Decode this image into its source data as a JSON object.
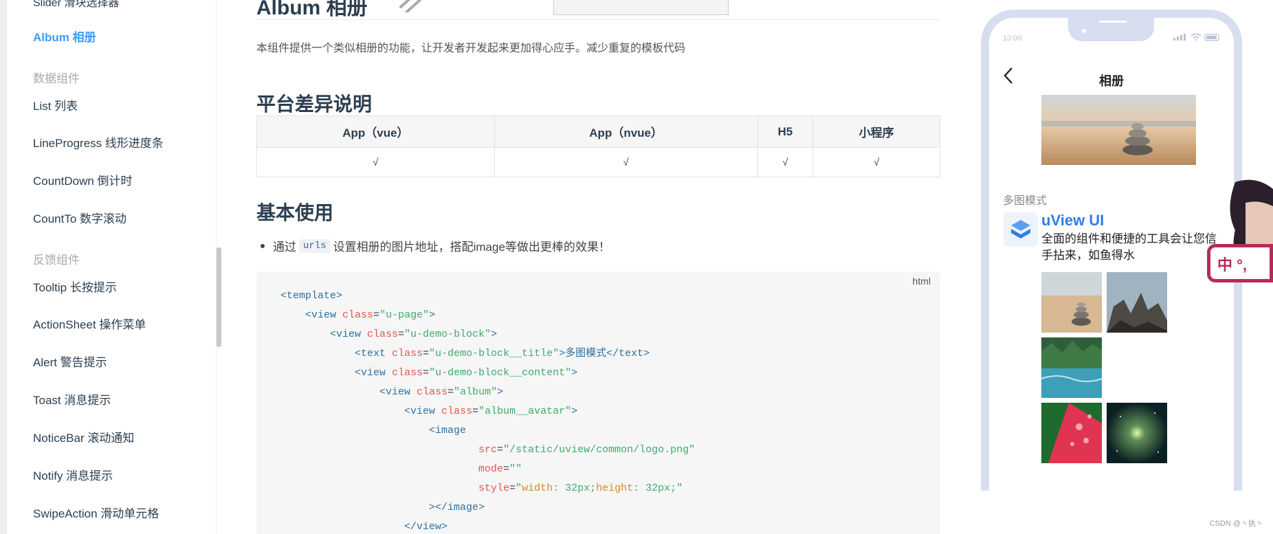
{
  "sidebar": {
    "top_partial": "Slider 滑块选择器",
    "items": [
      {
        "label": "Album 相册",
        "active": true
      },
      {
        "label": "数据组件",
        "group": true
      },
      {
        "label": "List 列表"
      },
      {
        "label": "LineProgress 线形进度条"
      },
      {
        "label": "CountDown 倒计时"
      },
      {
        "label": "CountTo 数字滚动"
      },
      {
        "label": "反馈组件",
        "group": true
      },
      {
        "label": "Tooltip 长按提示"
      },
      {
        "label": "ActionSheet 操作菜单"
      },
      {
        "label": "Alert 警告提示"
      },
      {
        "label": "Toast 消息提示"
      },
      {
        "label": "NoticeBar 滚动通知"
      },
      {
        "label": "Notify 消息提示"
      },
      {
        "label": "SwipeAction 滑动单元格"
      }
    ]
  },
  "main": {
    "title": "Album 相册",
    "description": "本组件提供一个类似相册的功能，让开发者开发起来更加得心应手。减少重复的模板代码",
    "section_platform": "平台差异说明",
    "platform_table": {
      "headers": [
        "App（vue）",
        "App（nvue）",
        "H5",
        "小程序"
      ],
      "row": [
        "√",
        "√",
        "√",
        "√"
      ]
    },
    "section_basic": "基本使用",
    "bullet": {
      "prefix": "通过",
      "code": "urls",
      "suffix": "设置相册的图片地址，搭配image等做出更棒的效果！"
    },
    "code_lang": "html"
  },
  "phone": {
    "status_time": "10:00",
    "title": "相册",
    "mode_label": "多图模式",
    "brand": "uView UI",
    "slogan": "全面的组件和便捷的工具会让您信手拈来，如鱼得水"
  },
  "ime_label": "中 °,",
  "watermark": "CSDN @丶执丶"
}
